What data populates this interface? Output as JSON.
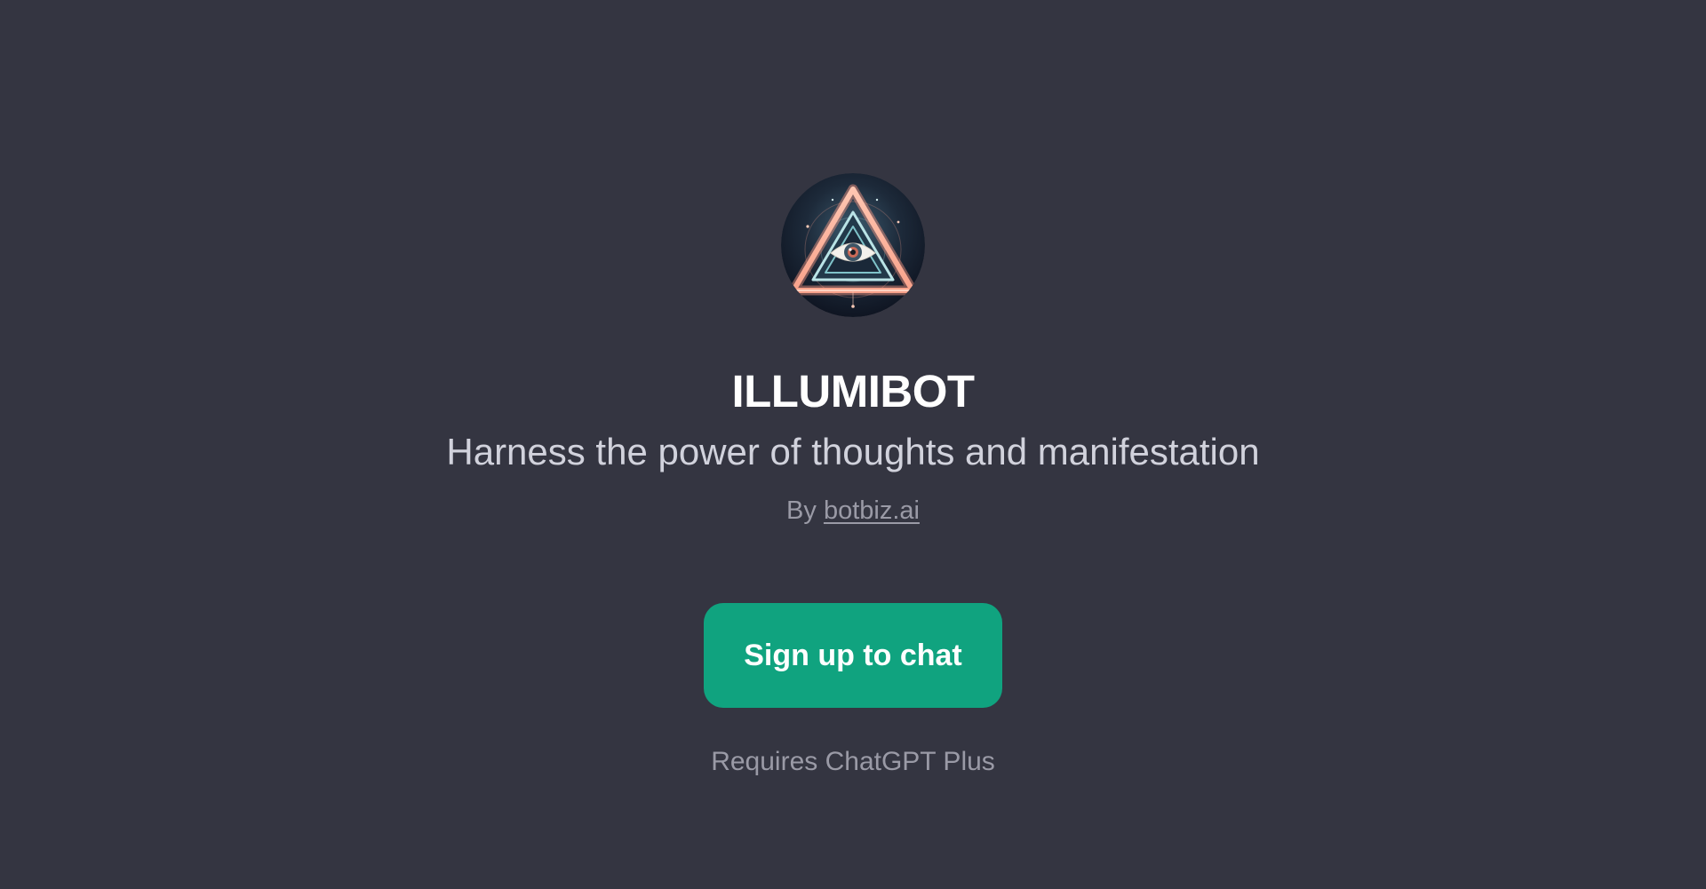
{
  "gpt": {
    "name": "ILLUMIBOT",
    "description": "Harness the power of thoughts and manifestation",
    "by_prefix": "By ",
    "author": "botbiz.ai",
    "avatar_icon": "all-seeing-eye-triangle-icon"
  },
  "cta": {
    "label": "Sign up to chat",
    "color": "#10a37f"
  },
  "footer": {
    "requirement": "Requires ChatGPT Plus"
  },
  "theme": {
    "background": "#343541"
  }
}
